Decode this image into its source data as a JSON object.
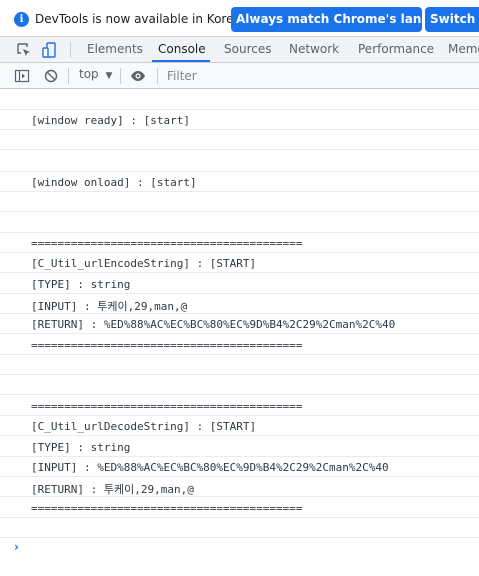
{
  "infobar": {
    "icon": "info-icon",
    "message": "DevTools is now available in Korean!",
    "match_button": "Always match Chrome's language",
    "switch_button": "Switch DevTools to Korean"
  },
  "tabs": [
    "Elements",
    "Console",
    "Sources",
    "Network",
    "Performance",
    "Memory"
  ],
  "active_tab": "Console",
  "console_toolbar": {
    "context": "top",
    "filter_placeholder": "Filter"
  },
  "console": {
    "messages": [
      "",
      "[window ready] : [start]",
      "",
      "",
      "[window onload] : [start]",
      "",
      "",
      "=========================================",
      "[C_Util_urlEncodeString] : [START]",
      "[TYPE] : string",
      "[INPUT] : 투케이,29,man,@",
      "[RETURN] : %ED%88%AC%EC%BC%80%EC%9D%B4%2C29%2Cman%2C%40",
      "=========================================",
      "",
      "",
      "=========================================",
      "[C_Util_urlDecodeString] : [START]",
      "[TYPE] : string",
      "[INPUT] : %ED%88%AC%EC%BC%80%EC%9D%B4%2C29%2Cman%2C%40",
      "[RETURN] : 투케이,29,man,@",
      "=========================================",
      ""
    ],
    "prompt": "›"
  },
  "colors": {
    "accent": "#1a73e8",
    "tab_bar_bg": "#f1f3f4",
    "console_text": "#303942"
  }
}
